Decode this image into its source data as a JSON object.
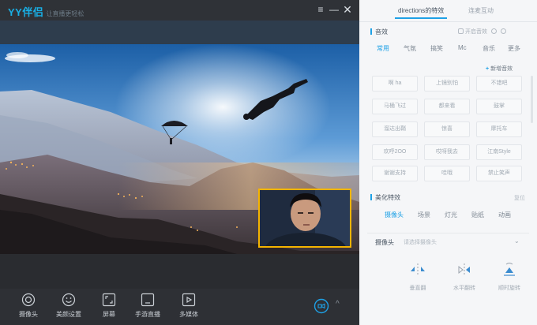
{
  "app": {
    "logo_text": "YY伴侣",
    "logo_subtitle": "让直播更轻松"
  },
  "window_controls": {
    "menu_icon": "≡",
    "minimize_icon": "—",
    "close_icon": "✕"
  },
  "toolbar": {
    "items": [
      {
        "label": "摄像头",
        "icon": "camera-icon"
      },
      {
        "label": "美颜设置",
        "icon": "beauty-face-icon"
      },
      {
        "label": "屏幕",
        "icon": "screen-capture-icon"
      },
      {
        "label": "手游直播",
        "icon": "mobile-game-icon"
      },
      {
        "label": "多媒体",
        "icon": "multimedia-icon"
      }
    ],
    "live_icon": "live-broadcast-icon",
    "expand_icon": "^"
  },
  "right_panel": {
    "tabs": [
      {
        "label": "directions的特效",
        "active": true
      },
      {
        "label": "连麦互动",
        "active": false
      }
    ],
    "sfx": {
      "title": "音效",
      "option_label": "开启音效",
      "categories": [
        {
          "label": "常用",
          "active": true
        },
        {
          "label": "气氛",
          "active": false
        },
        {
          "label": "搞笑",
          "active": false
        },
        {
          "label": "Mc",
          "active": false
        },
        {
          "label": "音乐",
          "active": false
        },
        {
          "label": "更多",
          "active": false
        }
      ],
      "add_label": "新增音效",
      "buttons": [
        "啊 ha",
        "上镜别怕",
        "不错吧",
        "马桶飞过",
        "都来看",
        "鼓掌",
        "溜达出鞘",
        "惊喜",
        "摩托车",
        "欢呼2OO",
        "哎呀我去",
        "江南Style",
        "谢谢支持",
        "哇哦",
        "禁止笑声"
      ]
    },
    "voice": {
      "title": "美化特效",
      "reset_label": "复位",
      "categories": [
        {
          "label": "摄像头",
          "active": true
        },
        {
          "label": "场景",
          "active": false
        },
        {
          "label": "灯光",
          "active": false
        },
        {
          "label": "贴纸",
          "active": false
        },
        {
          "label": "动画",
          "active": false
        }
      ]
    },
    "camera": {
      "label": "摄像头",
      "value": "请选择摄像头",
      "dropdown_icon": "⌄"
    },
    "adjust": [
      {
        "label": "垂直翻",
        "icon": "flip-vertical-icon"
      },
      {
        "label": "水平翻转",
        "icon": "flip-horizontal-icon"
      },
      {
        "label": "顺时旋转",
        "icon": "rotate-icon"
      }
    ]
  },
  "colors": {
    "accent": "#1ea1e6",
    "camera_border": "#f5b400",
    "logo": "#19b0e6"
  }
}
